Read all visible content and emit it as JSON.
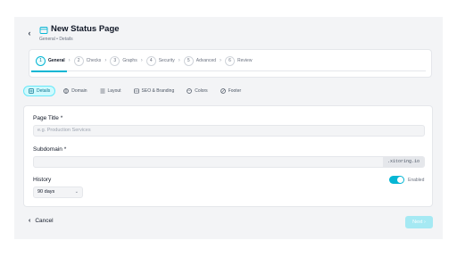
{
  "header": {
    "title": "New Status Page",
    "breadcrumb": "General • Details",
    "back_glyph": "‹"
  },
  "stepper": {
    "steps": [
      {
        "num": "1",
        "label": "General",
        "active": true
      },
      {
        "num": "2",
        "label": "Checks"
      },
      {
        "num": "3",
        "label": "Graphs"
      },
      {
        "num": "4",
        "label": "Security"
      },
      {
        "num": "5",
        "label": "Advanced"
      },
      {
        "num": "6",
        "label": "Review"
      }
    ],
    "separator": "›",
    "progress_fraction": 0.09
  },
  "tabs": [
    {
      "label": "Details",
      "icon": "details-icon",
      "active": true
    },
    {
      "label": "Domain",
      "icon": "globe-icon"
    },
    {
      "label": "Layout",
      "icon": "layout-icon"
    },
    {
      "label": "SEO & Branding",
      "icon": "seo-icon"
    },
    {
      "label": "Colors",
      "icon": "palette-icon"
    },
    {
      "label": "Footer",
      "icon": "footer-icon"
    }
  ],
  "form": {
    "page_title_label": "Page Title *",
    "page_title_placeholder": "e.g. Production Services",
    "subdomain_label": "Subdomain *",
    "subdomain_value": "",
    "subdomain_suffix": ".xitoring.io",
    "history_label": "History",
    "history_value": "90 days",
    "history_caret": "⌄",
    "enabled_label": "Enabled",
    "enabled_on": true
  },
  "footer": {
    "cancel_label": "Cancel",
    "cancel_glyph": "‹",
    "next_label": "Next ›"
  },
  "colors": {
    "accent": "#06b6d4",
    "accent_light": "#cffafe",
    "next_disabled": "#a5e9f3"
  }
}
